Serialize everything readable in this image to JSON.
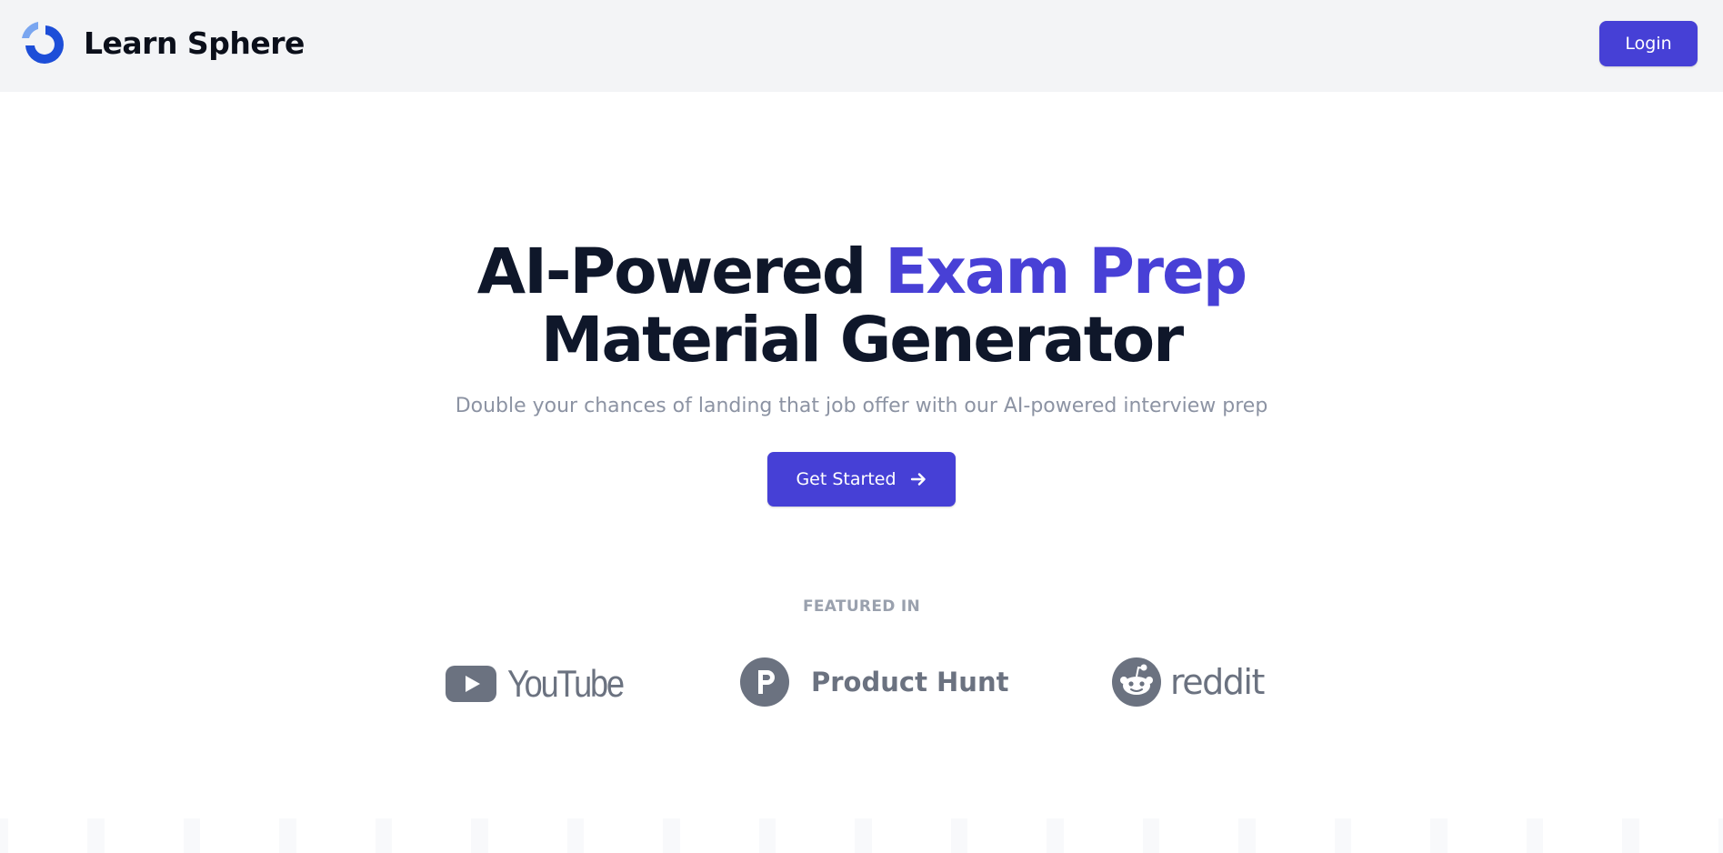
{
  "brand": {
    "name": "Learn Sphere",
    "logo_icon": "circular-arc-logo-icon"
  },
  "header": {
    "login_label": "Login"
  },
  "hero": {
    "title_part1": "AI-Powered ",
    "title_accent": "Exam Prep",
    "title_line2": "Material Generator",
    "subtitle": "Double your chances of landing that job offer with our AI-powered interview prep",
    "cta_label": "Get Started",
    "cta_icon": "arrow-right-icon"
  },
  "featured": {
    "label": "FEATURED IN",
    "logos": [
      {
        "name": "YouTube",
        "icon": "youtube-play-icon"
      },
      {
        "name": "Product Hunt",
        "icon": "product-hunt-p-icon"
      },
      {
        "name": "reddit",
        "icon": "reddit-alien-icon"
      }
    ]
  },
  "colors": {
    "accent": "#4640d6",
    "logo_blue": "#1d4ed8",
    "logo_light": "#7aa6f0",
    "muted_text": "#8c93a3",
    "logo_gray": "#6b7280"
  }
}
